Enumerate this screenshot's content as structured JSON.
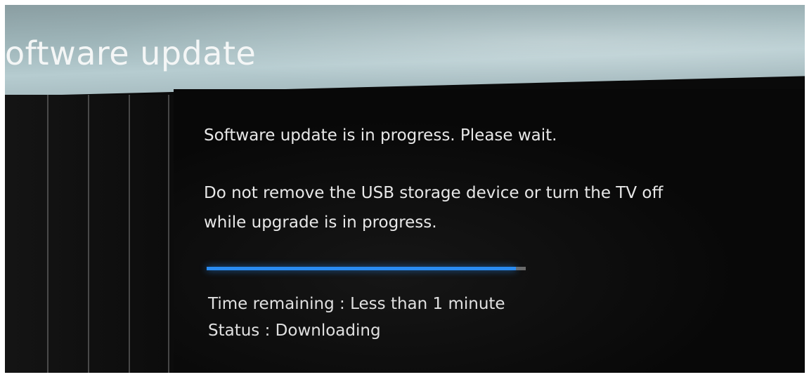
{
  "header": {
    "title": "oftware update"
  },
  "main": {
    "message_1": "Software update is in progress. Please wait.",
    "message_2_line1": "Do not remove the USB storage device or turn the TV off",
    "message_2_line2": "while upgrade is in progress.",
    "progress": {
      "fraction": 0.97,
      "fill_color": "#2a8cf2"
    },
    "time_remaining": "Time remaining : Less than 1 minute",
    "status": "Status : Downloading"
  }
}
